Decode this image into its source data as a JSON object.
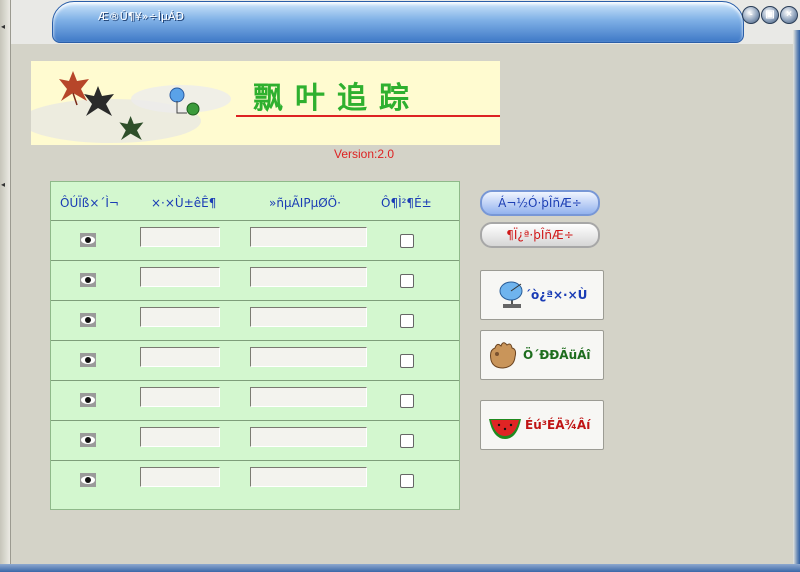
{
  "window": {
    "title": "Æ®Û¶¥»÷ÌµÁÐ",
    "buttons": {
      "minimize": "-",
      "restore": "▣",
      "close": "×"
    }
  },
  "banner": {
    "brand_text": "飘叶追踪",
    "version": "Version:2.0"
  },
  "table": {
    "headers": [
      "ÔÚÏß×´Ì¬",
      "×·×Ù±êÊ¶",
      "»ñµÃIPµØÖ·",
      "Ô¶Ì²¶É±"
    ],
    "rows": [
      {
        "online": true,
        "id": "",
        "ip": "",
        "checked": false
      },
      {
        "online": true,
        "id": "",
        "ip": "",
        "checked": false
      },
      {
        "online": true,
        "id": "",
        "ip": "",
        "checked": false
      },
      {
        "online": true,
        "id": "",
        "ip": "",
        "checked": false
      },
      {
        "online": true,
        "id": "",
        "ip": "",
        "checked": false
      },
      {
        "online": true,
        "id": "",
        "ip": "",
        "checked": false
      },
      {
        "online": true,
        "id": "",
        "ip": "",
        "checked": false
      }
    ]
  },
  "actions": {
    "connect_label": "Á¬½Ó·þÎñÆ÷",
    "disconnect_label": "¶Ï¿ª·þÎñÆ÷",
    "track_label": "´ò¿ª×·×Ù",
    "generate_label": "Ö´ÐÐÃüÁî",
    "exit_label": "Éú³ÉÄ¾Âí"
  },
  "colors": {
    "panel_bg": "#d3f7cf",
    "accent_blue": "#1a3cb5",
    "accent_red": "#d01818",
    "title_blue": "#3f79c7"
  }
}
